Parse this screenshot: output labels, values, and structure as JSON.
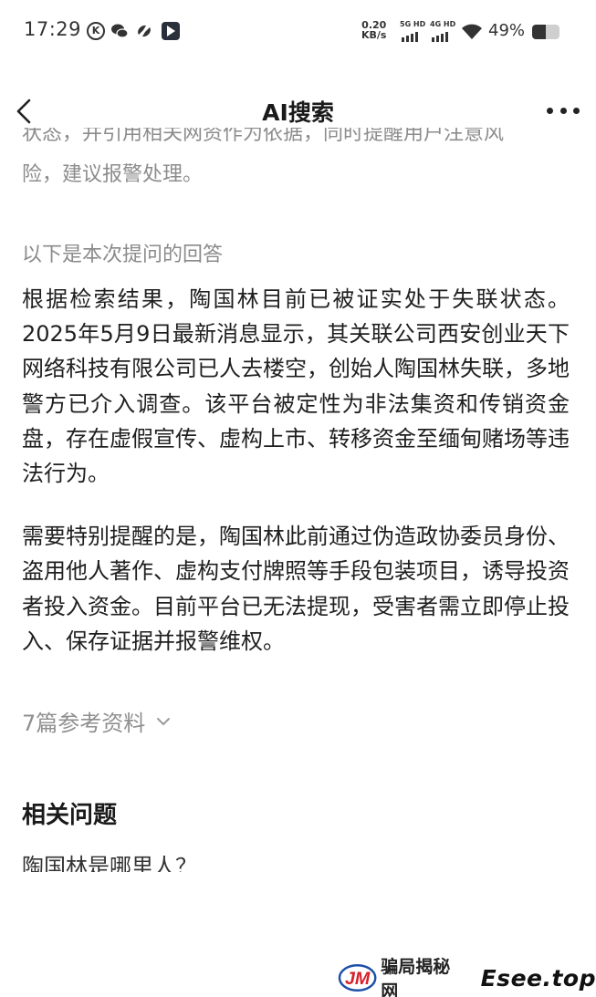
{
  "status_bar": {
    "time": "17:29",
    "net_speed_value": "0.20",
    "net_speed_unit": "KB/s",
    "sim1_label": "5G HD",
    "sim2_label": "4G HD",
    "battery_text": "49%",
    "battery_level": 0.49,
    "app_icons": [
      "k-circle-icon",
      "wechat-icon",
      "loop-icon",
      "play-store-icon"
    ]
  },
  "nav": {
    "title": "AI搜索",
    "back_icon": "chevron-left-icon",
    "more_icon": "more-dots-icon"
  },
  "content": {
    "prev_line1": "状态，并引用相关网资作为依据，同时提醒用户注意风",
    "prev_line2": "险，建议报警处理。",
    "answer_label": "以下是本次提问的回答",
    "paragraph1": "根据检索结果，陶国林目前已被证实处于失联状态。2025年5月9日最新消息显示，其关联公司西安创业天下网络科技有限公司已人去楼空，创始人陶国林失联，多地警方已介入调查。该平台被定性为非法集资和传销资金盘，存在虚假宣传、虚构上市、转移资金至缅甸赌场等违法行为。",
    "paragraph2": "需要特别提醒的是，陶国林此前通过伪造政协委员身份、盗用他人著作、虚构支付牌照等手段包装项目，诱导投资者投入资金。目前平台已无法提现，受害者需立即停止投入、保存证据并报警维权。",
    "references": "7篇参考资料",
    "related_title": "相关问题",
    "related_first": "陶国林是哪里人？"
  },
  "watermark": {
    "logo_text": "JM",
    "site_cn": "骗局揭秘网",
    "site_en": "Esee.top"
  },
  "colors": {
    "text_main": "#1f1f1f",
    "text_muted": "#8c8c8c",
    "background": "#ffffff",
    "watermark_red": "#d8202a",
    "watermark_blue": "#1b4fa8"
  }
}
